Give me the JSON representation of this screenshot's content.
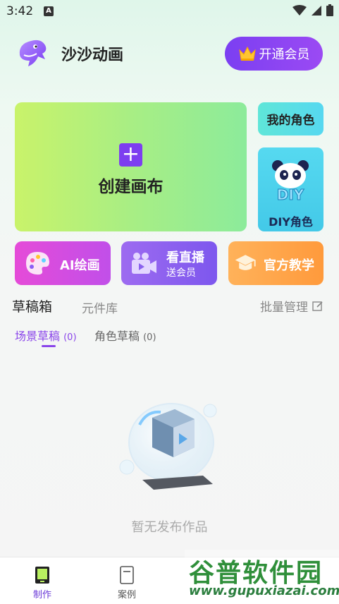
{
  "status": {
    "time": "3:42",
    "notif_letter": "A"
  },
  "header": {
    "title": "沙沙动画",
    "vip_label": "开通会员"
  },
  "create": {
    "label": "创建画布",
    "plus": "+"
  },
  "side": {
    "my_role": "我的角色",
    "diy_role": "DIY角色",
    "diy_logo_text": "DIY"
  },
  "features": {
    "ai": "AI绘画",
    "live": "看直播",
    "live_sub": "送会员",
    "tutorial": "官方教学"
  },
  "tabs": {
    "drafts": "草稿箱",
    "components": "元件库",
    "batch": "批量管理"
  },
  "subtabs": {
    "scene": "场景草稿",
    "scene_count": "(0)",
    "role": "角色草稿",
    "role_count": "(0)"
  },
  "empty": {
    "text": "暂无发布作品"
  },
  "nav": {
    "make": "制作",
    "cases": "案例"
  },
  "watermark": {
    "big": "谷普软件园",
    "url": "www.gupuxiazai.com"
  },
  "colors": {
    "accent": "#8a45ea",
    "create_green": "#a8ee84",
    "cyan": "#56d8f0",
    "orange": "#ff9a3c"
  }
}
